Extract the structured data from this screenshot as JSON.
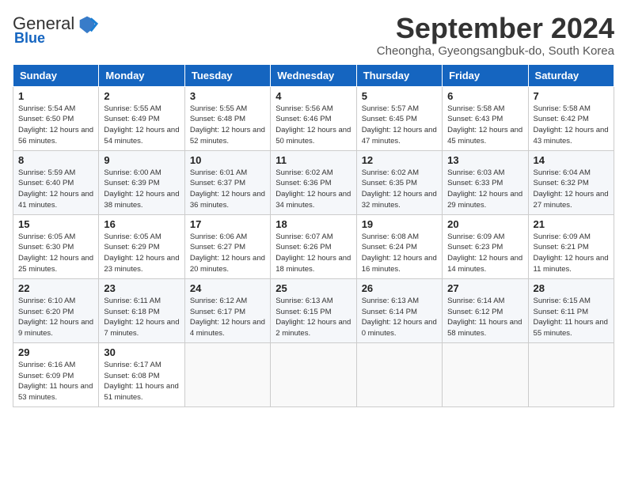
{
  "header": {
    "logo": {
      "general": "General",
      "blue": "Blue"
    },
    "month": "September 2024",
    "location": "Cheongha, Gyeongsangbuk-do, South Korea"
  },
  "weekdays": [
    "Sunday",
    "Monday",
    "Tuesday",
    "Wednesday",
    "Thursday",
    "Friday",
    "Saturday"
  ],
  "weeks": [
    [
      {
        "day": "1",
        "sunrise": "5:54 AM",
        "sunset": "6:50 PM",
        "daylight": "12 hours and 56 minutes."
      },
      {
        "day": "2",
        "sunrise": "5:55 AM",
        "sunset": "6:49 PM",
        "daylight": "12 hours and 54 minutes."
      },
      {
        "day": "3",
        "sunrise": "5:55 AM",
        "sunset": "6:48 PM",
        "daylight": "12 hours and 52 minutes."
      },
      {
        "day": "4",
        "sunrise": "5:56 AM",
        "sunset": "6:46 PM",
        "daylight": "12 hours and 50 minutes."
      },
      {
        "day": "5",
        "sunrise": "5:57 AM",
        "sunset": "6:45 PM",
        "daylight": "12 hours and 47 minutes."
      },
      {
        "day": "6",
        "sunrise": "5:58 AM",
        "sunset": "6:43 PM",
        "daylight": "12 hours and 45 minutes."
      },
      {
        "day": "7",
        "sunrise": "5:58 AM",
        "sunset": "6:42 PM",
        "daylight": "12 hours and 43 minutes."
      }
    ],
    [
      {
        "day": "8",
        "sunrise": "5:59 AM",
        "sunset": "6:40 PM",
        "daylight": "12 hours and 41 minutes."
      },
      {
        "day": "9",
        "sunrise": "6:00 AM",
        "sunset": "6:39 PM",
        "daylight": "12 hours and 38 minutes."
      },
      {
        "day": "10",
        "sunrise": "6:01 AM",
        "sunset": "6:37 PM",
        "daylight": "12 hours and 36 minutes."
      },
      {
        "day": "11",
        "sunrise": "6:02 AM",
        "sunset": "6:36 PM",
        "daylight": "12 hours and 34 minutes."
      },
      {
        "day": "12",
        "sunrise": "6:02 AM",
        "sunset": "6:35 PM",
        "daylight": "12 hours and 32 minutes."
      },
      {
        "day": "13",
        "sunrise": "6:03 AM",
        "sunset": "6:33 PM",
        "daylight": "12 hours and 29 minutes."
      },
      {
        "day": "14",
        "sunrise": "6:04 AM",
        "sunset": "6:32 PM",
        "daylight": "12 hours and 27 minutes."
      }
    ],
    [
      {
        "day": "15",
        "sunrise": "6:05 AM",
        "sunset": "6:30 PM",
        "daylight": "12 hours and 25 minutes."
      },
      {
        "day": "16",
        "sunrise": "6:05 AM",
        "sunset": "6:29 PM",
        "daylight": "12 hours and 23 minutes."
      },
      {
        "day": "17",
        "sunrise": "6:06 AM",
        "sunset": "6:27 PM",
        "daylight": "12 hours and 20 minutes."
      },
      {
        "day": "18",
        "sunrise": "6:07 AM",
        "sunset": "6:26 PM",
        "daylight": "12 hours and 18 minutes."
      },
      {
        "day": "19",
        "sunrise": "6:08 AM",
        "sunset": "6:24 PM",
        "daylight": "12 hours and 16 minutes."
      },
      {
        "day": "20",
        "sunrise": "6:09 AM",
        "sunset": "6:23 PM",
        "daylight": "12 hours and 14 minutes."
      },
      {
        "day": "21",
        "sunrise": "6:09 AM",
        "sunset": "6:21 PM",
        "daylight": "12 hours and 11 minutes."
      }
    ],
    [
      {
        "day": "22",
        "sunrise": "6:10 AM",
        "sunset": "6:20 PM",
        "daylight": "12 hours and 9 minutes."
      },
      {
        "day": "23",
        "sunrise": "6:11 AM",
        "sunset": "6:18 PM",
        "daylight": "12 hours and 7 minutes."
      },
      {
        "day": "24",
        "sunrise": "6:12 AM",
        "sunset": "6:17 PM",
        "daylight": "12 hours and 4 minutes."
      },
      {
        "day": "25",
        "sunrise": "6:13 AM",
        "sunset": "6:15 PM",
        "daylight": "12 hours and 2 minutes."
      },
      {
        "day": "26",
        "sunrise": "6:13 AM",
        "sunset": "6:14 PM",
        "daylight": "12 hours and 0 minutes."
      },
      {
        "day": "27",
        "sunrise": "6:14 AM",
        "sunset": "6:12 PM",
        "daylight": "11 hours and 58 minutes."
      },
      {
        "day": "28",
        "sunrise": "6:15 AM",
        "sunset": "6:11 PM",
        "daylight": "11 hours and 55 minutes."
      }
    ],
    [
      {
        "day": "29",
        "sunrise": "6:16 AM",
        "sunset": "6:09 PM",
        "daylight": "11 hours and 53 minutes."
      },
      {
        "day": "30",
        "sunrise": "6:17 AM",
        "sunset": "6:08 PM",
        "daylight": "11 hours and 51 minutes."
      },
      null,
      null,
      null,
      null,
      null
    ]
  ],
  "labels": {
    "sunrise": "Sunrise:",
    "sunset": "Sunset:",
    "daylight": "Daylight:"
  }
}
